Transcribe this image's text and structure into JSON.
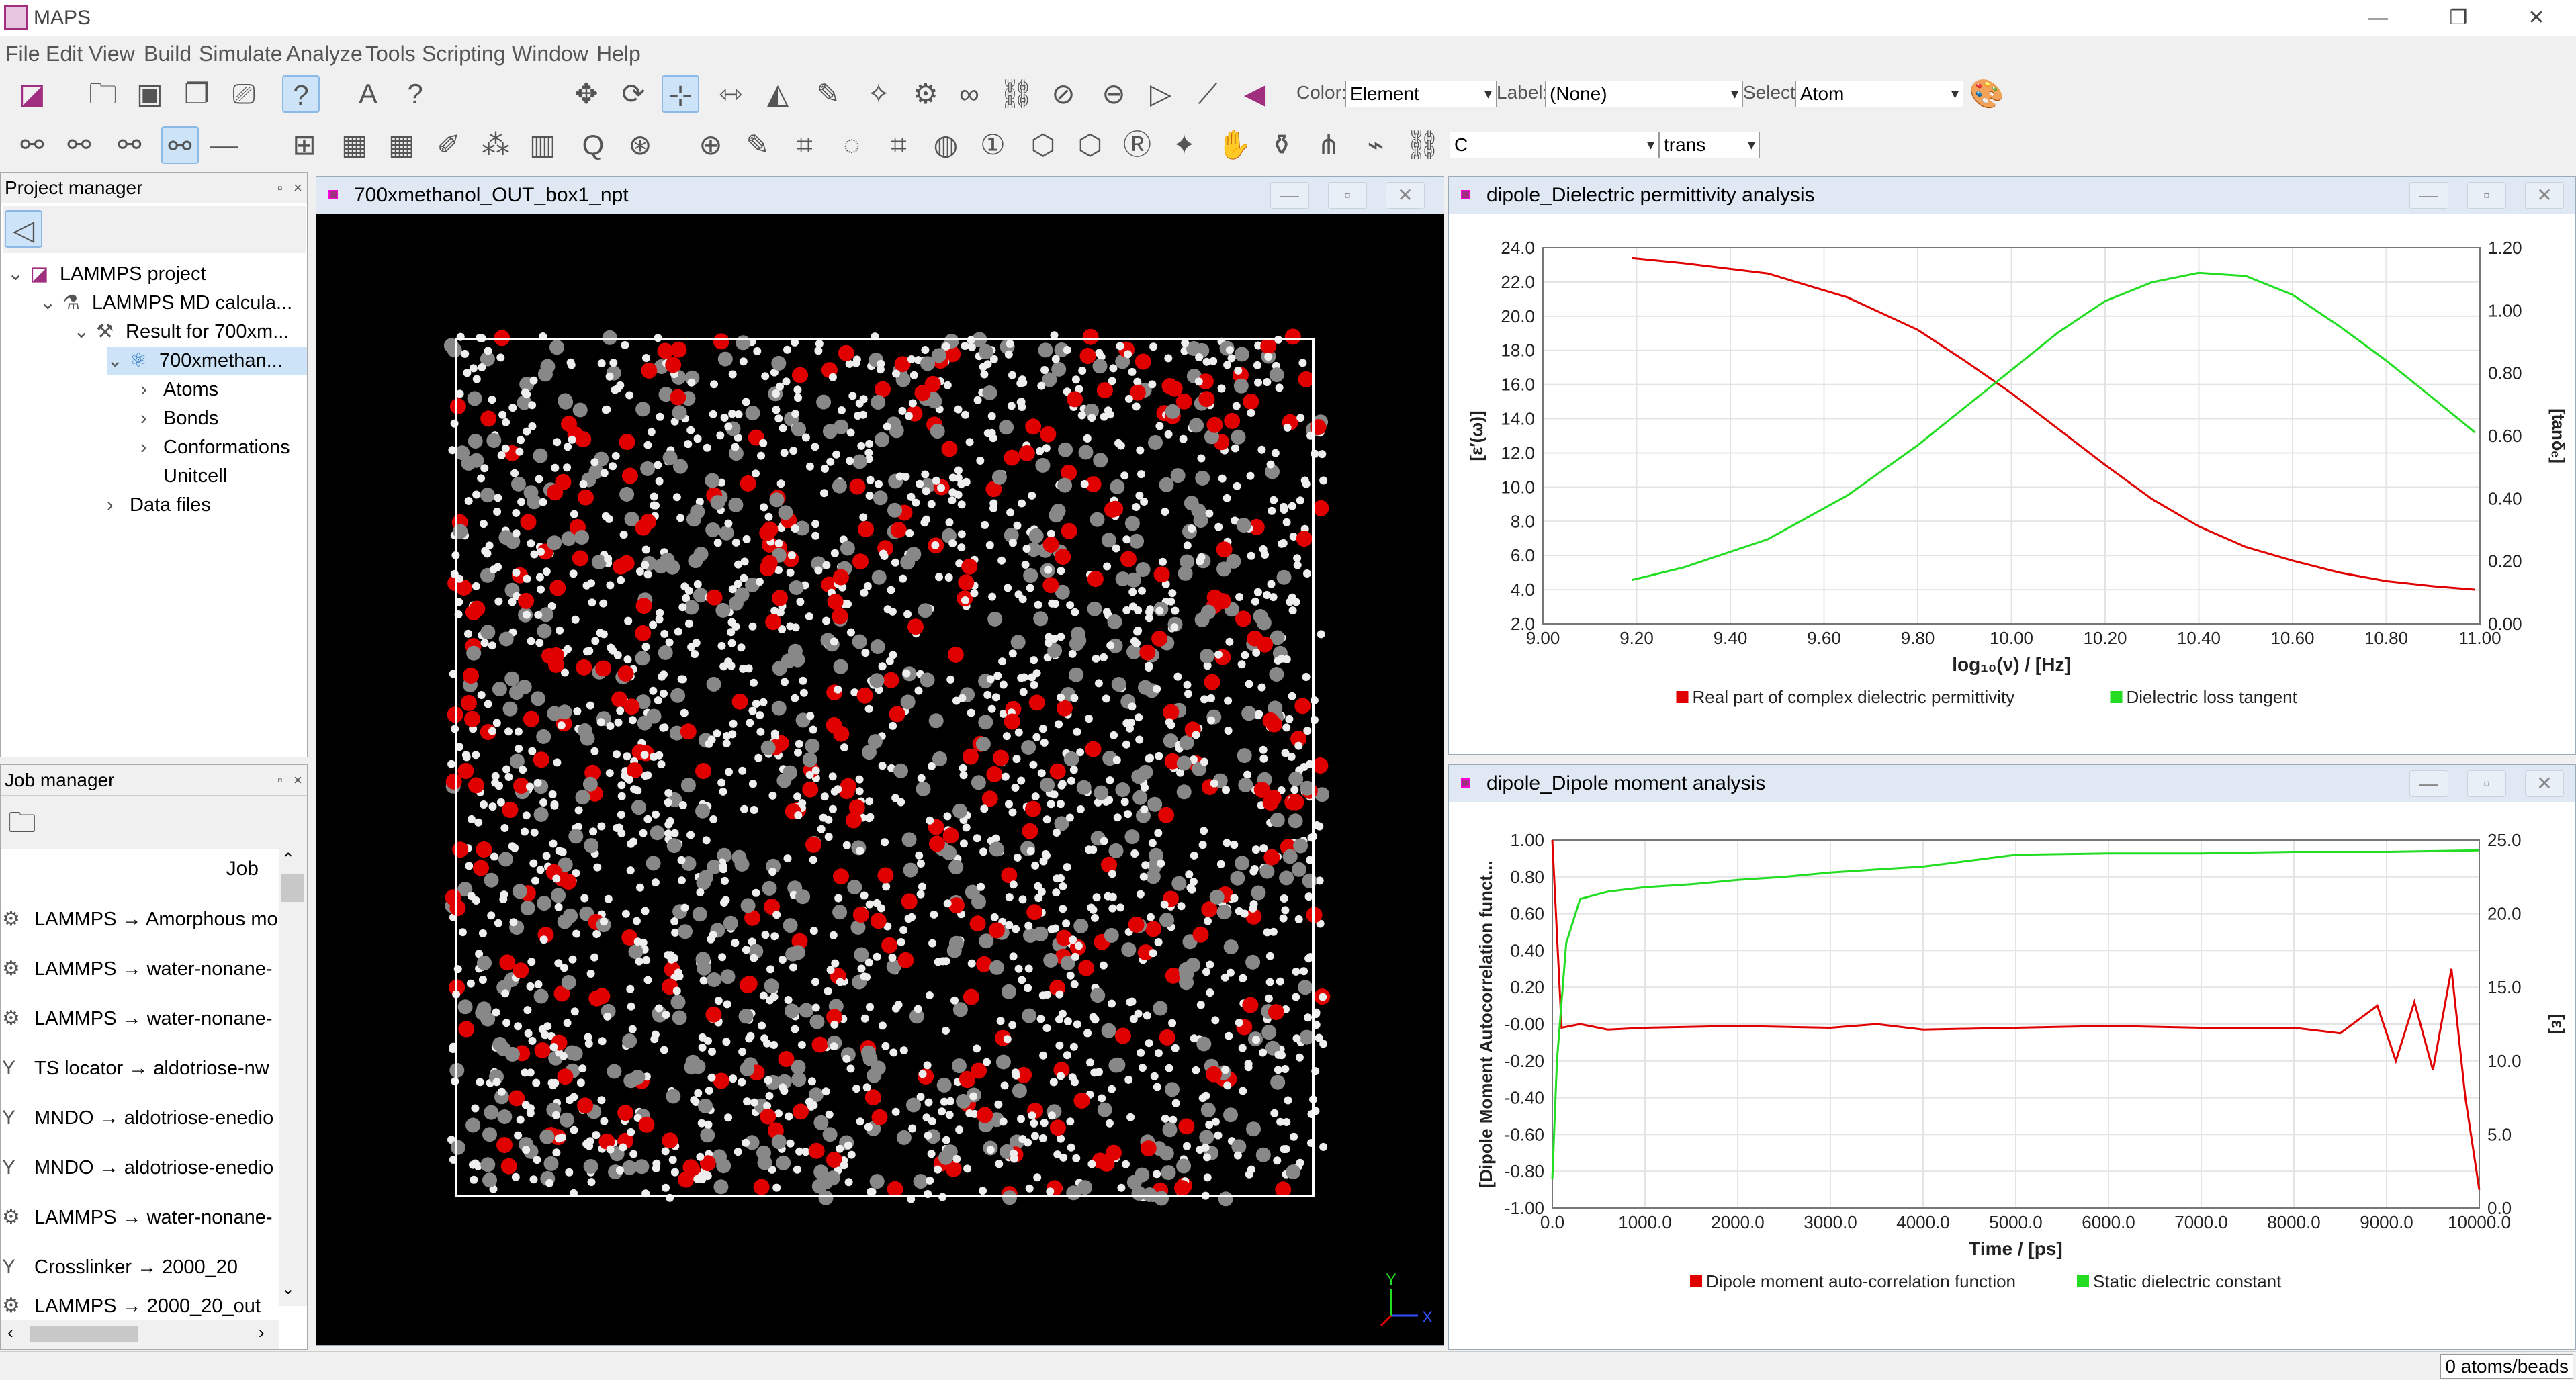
{
  "app": {
    "title": "MAPS"
  },
  "window_controls": {
    "minimize": "—",
    "maximize": "❐",
    "close": "✕"
  },
  "menu": [
    "File",
    "Edit",
    "View",
    "Build",
    "Simulate",
    "Analyze",
    "Tools",
    "Scripting",
    "Window",
    "Help"
  ],
  "toolbar": {
    "color_label": "Color:",
    "color_value": "Element",
    "label_label": "Label:",
    "label_value": "(None)",
    "select_label": "Select:",
    "select_value": "Atom",
    "element_input": "C",
    "bond_mode": "trans"
  },
  "project_manager": {
    "title": "Project manager",
    "tree": [
      {
        "label": "LAMMPS project",
        "level": 0,
        "arrow": "⌄"
      },
      {
        "label": "LAMMPS MD calcula...",
        "level": 1,
        "arrow": "⌄"
      },
      {
        "label": "Result for 700xm...",
        "level": 2,
        "arrow": "⌄"
      },
      {
        "label": "700xmethan...",
        "level": 3,
        "arrow": "⌄",
        "selected": true
      },
      {
        "label": "Atoms",
        "level": 4,
        "arrow": "›"
      },
      {
        "label": "Bonds",
        "level": 4,
        "arrow": "›"
      },
      {
        "label": "Conformations",
        "level": 4,
        "arrow": "›"
      },
      {
        "label": "Unitcell",
        "level": 4,
        "arrow": ""
      },
      {
        "label": "Data files",
        "level": 3,
        "arrow": "›"
      }
    ]
  },
  "job_manager": {
    "title": "Job manager",
    "column": "Job",
    "jobs": [
      "LAMMPS → Amorphous mo",
      "LAMMPS → water-nonane-",
      "LAMMPS → water-nonane-",
      "TS locator → aldotriose-nw",
      "MNDO → aldotriose-enedio",
      "MNDO → aldotriose-enedio",
      "LAMMPS → water-nonane-",
      "Crosslinker → 2000_20",
      "LAMMPS → 2000_20_out"
    ]
  },
  "viewer": {
    "title": "700xmethanol_OUT_box1_npt",
    "axis_x": "X",
    "axis_y": "Y"
  },
  "dielectric_window": {
    "title": "dipole_Dielectric permittivity analysis"
  },
  "dipole_window": {
    "title": "dipole_Dipole moment analysis"
  },
  "status": {
    "count": "0 atoms/beads"
  },
  "colors": {
    "red": "#e00000",
    "green": "#22dd22",
    "accent": "#a0307f"
  },
  "chart_data": [
    {
      "type": "line",
      "xlabel": "log₁₀(ν) / [Hz]",
      "ylabel": "[ε′(ω)]",
      "y2label": "[tanδₑ]",
      "xlim": [
        9.0,
        11.0
      ],
      "ylim": [
        2.0,
        24.0
      ],
      "y2lim": [
        0.0,
        1.2
      ],
      "x_ticks": [
        "9.00",
        "9.20",
        "9.40",
        "9.60",
        "9.80",
        "10.00",
        "10.20",
        "10.40",
        "10.60",
        "10.80",
        "11.00"
      ],
      "y_ticks": [
        "2.0",
        "4.0",
        "6.0",
        "8.0",
        "10.0",
        "12.0",
        "14.0",
        "16.0",
        "18.0",
        "20.0",
        "22.0",
        "24.0"
      ],
      "y2_ticks": [
        "0.00",
        "0.20",
        "0.40",
        "0.60",
        "0.80",
        "1.00",
        "1.20"
      ],
      "grid": true,
      "legend": "bottom",
      "series": [
        {
          "name": "Real part of complex dielectric permittivity",
          "axis": "left",
          "color": "#e00000",
          "x": [
            9.19,
            9.3,
            9.48,
            9.65,
            9.8,
            9.9,
            10.0,
            10.1,
            10.2,
            10.3,
            10.4,
            10.5,
            10.6,
            10.7,
            10.8,
            10.9,
            10.99
          ],
          "y": [
            23.4,
            23.1,
            22.5,
            21.1,
            19.2,
            17.4,
            15.5,
            13.4,
            11.3,
            9.3,
            7.7,
            6.5,
            5.7,
            5.0,
            4.5,
            4.2,
            4.0
          ]
        },
        {
          "name": "Dielectric loss tangent",
          "axis": "right",
          "color": "#22dd22",
          "x": [
            9.19,
            9.3,
            9.48,
            9.65,
            9.8,
            9.9,
            10.0,
            10.1,
            10.2,
            10.3,
            10.4,
            10.5,
            10.6,
            10.7,
            10.8,
            10.9,
            10.99
          ],
          "y": [
            0.14,
            0.18,
            0.27,
            0.41,
            0.57,
            0.69,
            0.81,
            0.93,
            1.03,
            1.09,
            1.12,
            1.11,
            1.05,
            0.95,
            0.84,
            0.72,
            0.61
          ]
        }
      ]
    },
    {
      "type": "line",
      "xlabel": "Time / [ps]",
      "ylabel": "[Dipole Moment Autocorrelation funct...",
      "y2label": "[ε]",
      "xlim": [
        0.0,
        10000.0
      ],
      "ylim": [
        -1.0,
        1.0
      ],
      "y2lim": [
        0.0,
        25.0
      ],
      "x_ticks": [
        "0.0",
        "1000.0",
        "2000.0",
        "3000.0",
        "4000.0",
        "5000.0",
        "6000.0",
        "7000.0",
        "8000.0",
        "9000.0",
        "10000.0"
      ],
      "y_ticks": [
        "-1.00",
        "-0.80",
        "-0.60",
        "-0.40",
        "-0.20",
        "-0.00",
        "0.20",
        "0.40",
        "0.60",
        "0.80",
        "1.00"
      ],
      "y2_ticks": [
        "0.0",
        "5.0",
        "10.0",
        "15.0",
        "20.0",
        "25.0"
      ],
      "grid": true,
      "legend": "bottom",
      "series": [
        {
          "name": "Dipole moment auto-correlation function",
          "axis": "left",
          "color": "#e00000",
          "x": [
            0,
            100,
            300,
            600,
            1000,
            2000,
            3000,
            3500,
            4000,
            5000,
            6000,
            7000,
            8000,
            8500,
            8900,
            9100,
            9300,
            9500,
            9700,
            9850,
            10000
          ],
          "y": [
            1.0,
            -0.02,
            0.0,
            -0.03,
            -0.02,
            -0.01,
            -0.02,
            0.0,
            -0.03,
            -0.02,
            -0.01,
            -0.02,
            -0.02,
            -0.05,
            0.1,
            -0.2,
            0.12,
            -0.25,
            0.3,
            -0.4,
            -0.9
          ]
        },
        {
          "name": "Static dielectric constant",
          "axis": "right",
          "color": "#22dd22",
          "x": [
            0,
            50,
            150,
            300,
            600,
            1000,
            1500,
            2000,
            2500,
            3000,
            3500,
            4000,
            4500,
            5000,
            6000,
            7000,
            8000,
            9000,
            10000
          ],
          "y": [
            2.0,
            10.0,
            18.0,
            21.0,
            21.5,
            21.8,
            22.0,
            22.3,
            22.5,
            22.8,
            23.0,
            23.2,
            23.6,
            24.0,
            24.1,
            24.1,
            24.2,
            24.2,
            24.3
          ]
        }
      ]
    }
  ]
}
